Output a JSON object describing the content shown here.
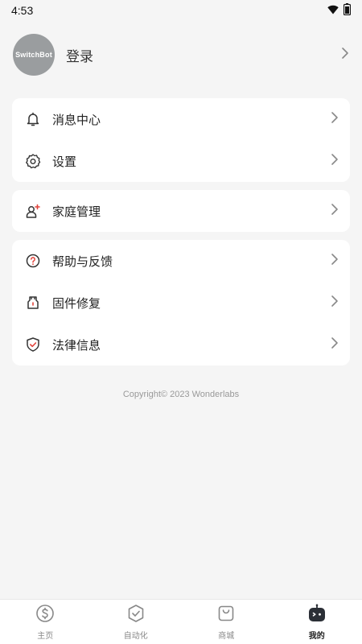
{
  "status_bar": {
    "time": "4:53"
  },
  "profile": {
    "avatar_text": "SwitchBot",
    "login_label": "登录"
  },
  "menu_group_1": [
    {
      "label": "消息中心",
      "icon": "bell-icon"
    },
    {
      "label": "设置",
      "icon": "gear-icon"
    }
  ],
  "menu_group_2": [
    {
      "label": "家庭管理",
      "icon": "family-add-icon"
    }
  ],
  "menu_group_3": [
    {
      "label": "帮助与反馈",
      "icon": "help-icon"
    },
    {
      "label": "固件修复",
      "icon": "firmware-repair-icon"
    },
    {
      "label": "法律信息",
      "icon": "shield-check-icon"
    }
  ],
  "copyright": "Copyright© 2023 Wonderlabs",
  "tabs": [
    {
      "label": "主页",
      "icon": "dollar-circle-icon",
      "active": false
    },
    {
      "label": "自动化",
      "icon": "check-hexagon-icon",
      "active": false
    },
    {
      "label": "商城",
      "icon": "shopping-bag-icon",
      "active": false
    },
    {
      "label": "我的",
      "icon": "robot-icon",
      "active": true
    }
  ]
}
